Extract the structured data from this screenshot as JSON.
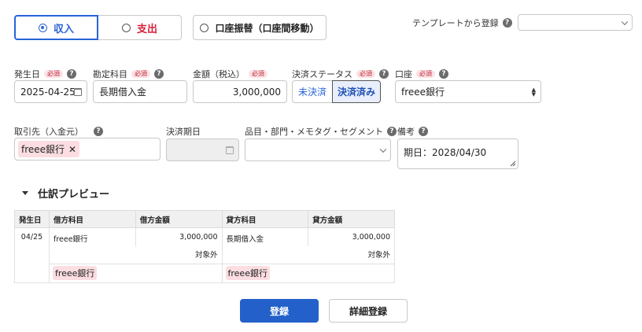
{
  "type_toggle": {
    "income_label": "収入",
    "expense_label": "支出",
    "selected": "income"
  },
  "transfer_label": "口座振替（口座間移動）",
  "template": {
    "label": "テンプレートから登録",
    "value": ""
  },
  "required_badge": "必須",
  "fields": {
    "date": {
      "label": "発生日",
      "value": "2025-04-25"
    },
    "account_item": {
      "label": "勘定科目",
      "value": "長期借入金"
    },
    "amount": {
      "label": "金額（税込）",
      "value": "3,000,000"
    },
    "settlement_status": {
      "label": "決済ステータス",
      "option_unsettled": "未決済",
      "option_settled": "決済済み",
      "selected": "決済済み"
    },
    "wallet": {
      "label": "口座",
      "value": "freee銀行"
    },
    "partner": {
      "label": "取引先（入金元）",
      "tag": "freee銀行"
    },
    "due_date": {
      "label": "決済期日",
      "value": ""
    },
    "items": {
      "label": "品目・部門・メモタグ・セグメント",
      "value": ""
    },
    "memo": {
      "label": "備考",
      "value": "期日：2028/04/30"
    }
  },
  "preview": {
    "label": "仕訳プレビュー",
    "headers": [
      "発生日",
      "借方科目",
      "借方金額",
      "貸方科目",
      "貸方金額"
    ],
    "date": "04/25",
    "debit_account": "freee銀行",
    "debit_amount": "3,000,000",
    "debit_tax": "対象外",
    "debit_tag": "freee銀行",
    "credit_account": "長期借入金",
    "credit_amount": "3,000,000",
    "credit_tax": "対象外",
    "credit_tag": "freee銀行"
  },
  "buttons": {
    "register": "登録",
    "detail_register": "詳細登録"
  },
  "colors": {
    "primary": "#2360c9",
    "income": "#2864d6",
    "expense": "#d8213a",
    "tag_bg": "#fbdde2"
  }
}
